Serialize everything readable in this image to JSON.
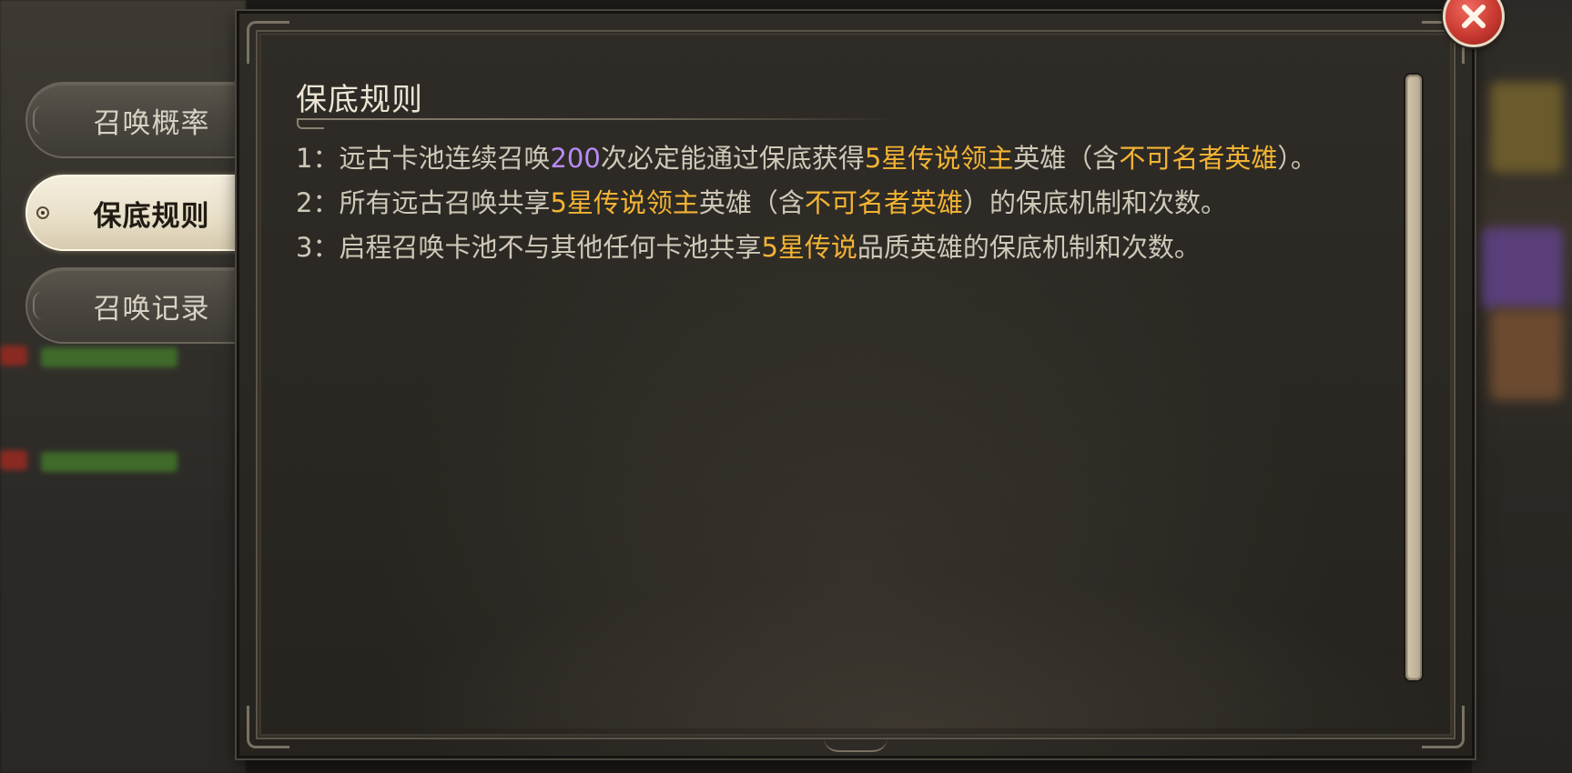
{
  "tabs": [
    {
      "label": "召唤概率",
      "active": false
    },
    {
      "label": "保底规则",
      "active": true
    },
    {
      "label": "召唤记录",
      "active": false
    }
  ],
  "panel": {
    "title": "保底规则",
    "rules": [
      {
        "num": "1：",
        "parts": [
          {
            "text": "远古卡池连续召唤",
            "style": "normal"
          },
          {
            "text": "200",
            "style": "purple"
          },
          {
            "text": "次必定能通过保底获得",
            "style": "normal"
          },
          {
            "text": "5星传说领主",
            "style": "gold"
          },
          {
            "text": "英雄（含",
            "style": "normal"
          },
          {
            "text": "不可名者英雄",
            "style": "gold"
          },
          {
            "text": "）。",
            "style": "normal"
          }
        ]
      },
      {
        "num": "2：",
        "parts": [
          {
            "text": "所有远古召唤共享",
            "style": "normal"
          },
          {
            "text": "5星传说领主",
            "style": "gold"
          },
          {
            "text": "英雄（含",
            "style": "normal"
          },
          {
            "text": "不可名者英雄",
            "style": "gold"
          },
          {
            "text": "）的保底机制和次数。",
            "style": "normal"
          }
        ]
      },
      {
        "num": "3：",
        "parts": [
          {
            "text": "启程召唤卡池不与其他任何卡池共享",
            "style": "normal"
          },
          {
            "text": "5星传说",
            "style": "gold"
          },
          {
            "text": "品质英雄的保底机制和次数。",
            "style": "normal"
          }
        ]
      }
    ]
  },
  "icons": {
    "close": "close-icon"
  },
  "colors": {
    "highlight_gold": "#f3b334",
    "highlight_purple": "#b98cf5",
    "body_text": "#cfc8b8",
    "close_button": "#c93a31"
  }
}
